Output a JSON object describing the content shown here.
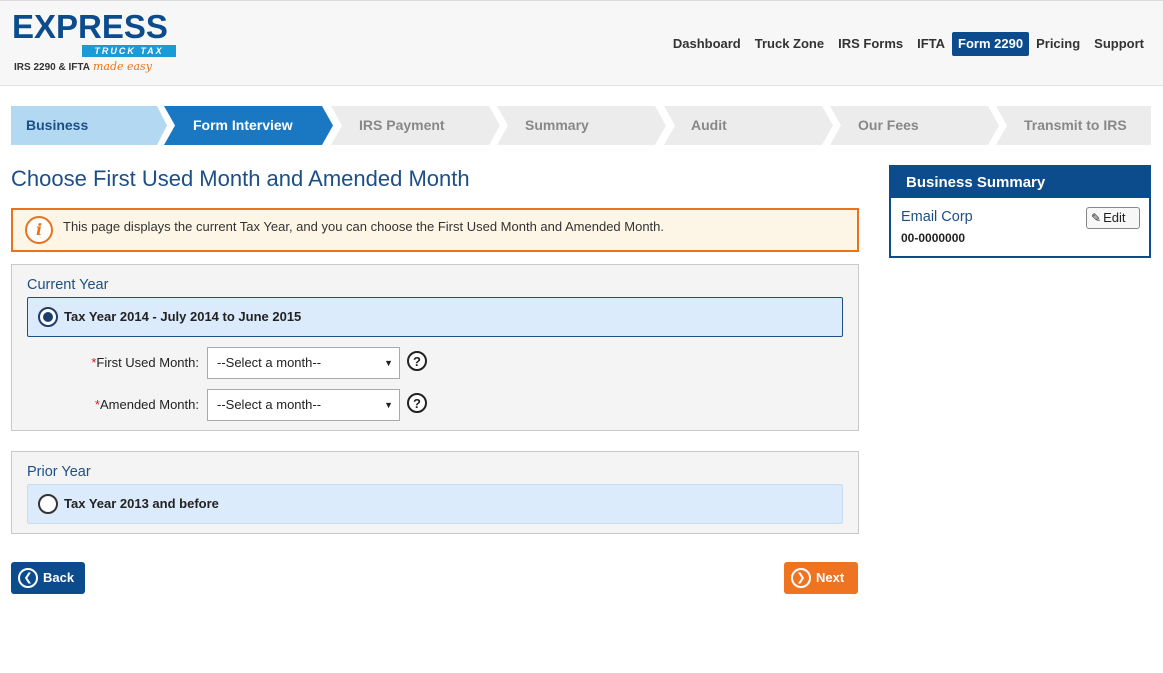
{
  "logo": {
    "brand": "EXPRESS",
    "band": "TRUCK TAX",
    "tagline": "IRS 2290 & IFTA",
    "tagline_script": "made easy"
  },
  "nav": {
    "items": [
      {
        "label": "Dashboard",
        "active": false
      },
      {
        "label": "Truck Zone",
        "active": false
      },
      {
        "label": "IRS Forms",
        "active": false
      },
      {
        "label": "IFTA",
        "active": false
      },
      {
        "label": "Form 2290",
        "active": true
      },
      {
        "label": "Pricing",
        "active": false
      },
      {
        "label": "Support",
        "active": false
      }
    ]
  },
  "stepper": {
    "steps": [
      {
        "label": "Business",
        "state": "completed"
      },
      {
        "label": "Form Interview",
        "state": "current"
      },
      {
        "label": "IRS Payment",
        "state": "pending"
      },
      {
        "label": "Summary",
        "state": "pending"
      },
      {
        "label": "Audit",
        "state": "pending"
      },
      {
        "label": "Our Fees",
        "state": "pending"
      },
      {
        "label": "Transmit to IRS",
        "state": "pending"
      }
    ]
  },
  "page": {
    "title": "Choose First Used Month and Amended Month",
    "info_text": "This page displays the current Tax Year, and you can choose the First Used Month and Amended Month."
  },
  "current_year": {
    "title": "Current Year",
    "option_label": "Tax Year 2014 - July 2014 to June 2015",
    "selected": true,
    "first_used_label": "First Used Month:",
    "first_used_value": "--Select a month--",
    "amended_label": "Amended Month:",
    "amended_value": "--Select a month--",
    "required_mark": "*"
  },
  "prior_year": {
    "title": "Prior Year",
    "option_label": "Tax Year 2013 and before",
    "selected": false
  },
  "buttons": {
    "back": "Back",
    "next": "Next"
  },
  "business_summary": {
    "title": "Business Summary",
    "name": "Email Corp",
    "ein": "00-0000000",
    "edit_label": "Edit"
  },
  "colors": {
    "primary": "#0d4c8c",
    "accent": "#ef7421",
    "step_completed": "#b3d9f2",
    "step_current": "#1a78c2",
    "step_pending": "#ececec"
  }
}
